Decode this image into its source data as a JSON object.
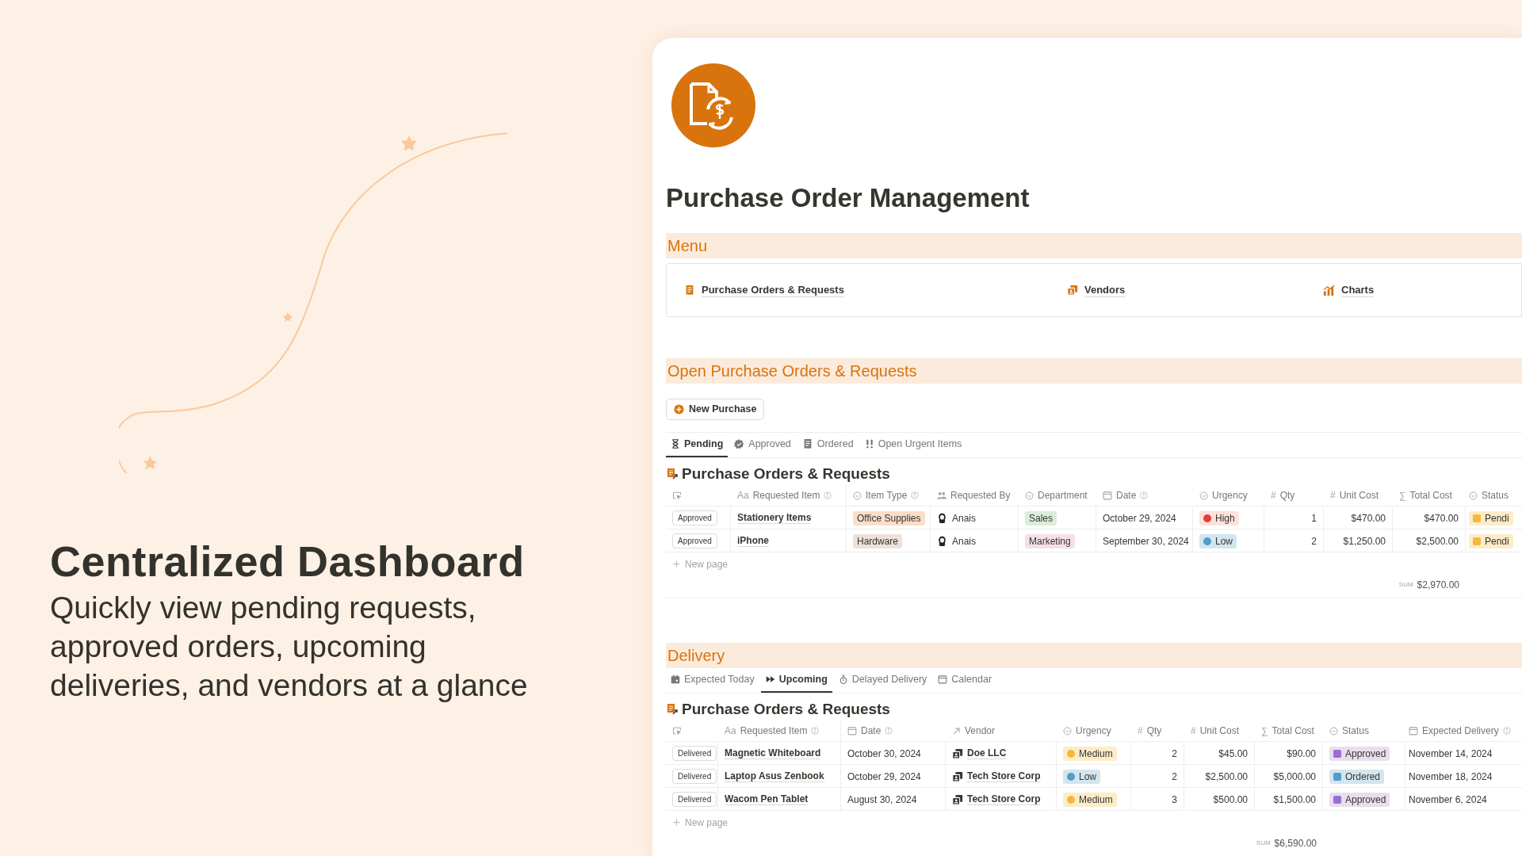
{
  "hero": {
    "heading": "Centralized Dashboard",
    "body": "Quickly view pending requests, approved orders, upcoming deliveries, and vendors at a glance"
  },
  "page": {
    "title": "Purchase Order Management"
  },
  "menu": {
    "heading": "Menu",
    "items": [
      {
        "label": "Purchase Orders & Requests"
      },
      {
        "label": "Vendors"
      },
      {
        "label": "Charts"
      }
    ]
  },
  "open_orders": {
    "heading": "Open Purchase Orders & Requests",
    "new_button": "New Purchase",
    "tabs": [
      {
        "label": "Pending",
        "selected": true
      },
      {
        "label": "Approved",
        "selected": false
      },
      {
        "label": "Ordered",
        "selected": false
      },
      {
        "label": "Open Urgent Items",
        "selected": false
      }
    ],
    "table": {
      "title": "Purchase Orders & Requests",
      "columns": [
        {
          "kind": "button"
        },
        {
          "kind": "title",
          "glyph": "Aa",
          "label": "Requested Item",
          "info": true
        },
        {
          "kind": "tag",
          "label": "Item Type",
          "info": true
        },
        {
          "kind": "person",
          "label": "Requested By",
          "info": false
        },
        {
          "kind": "tag",
          "label": "Department",
          "info": false
        },
        {
          "kind": "date",
          "label": "Date",
          "info": true
        },
        {
          "kind": "priority",
          "label": "Urgency",
          "info": false
        },
        {
          "kind": "number",
          "glyph": "#",
          "label": "Qty",
          "info": false
        },
        {
          "kind": "number",
          "glyph": "#",
          "label": "Unit Cost",
          "info": false
        },
        {
          "kind": "formula",
          "glyph": "∑",
          "label": "Total Cost",
          "info": false
        },
        {
          "kind": "status",
          "label": "Status",
          "info": false
        }
      ],
      "rows": [
        {
          "cells": [
            "Approved",
            "Stationery Items",
            {
              "text": "Office Supplies",
              "color": "#fadec9"
            },
            "Anais",
            {
              "text": "Sales",
              "color": "#dbeddb"
            },
            "October 29, 2024",
            {
              "text": "High",
              "color": "#e03e3e"
            },
            "1",
            "$470.00",
            "$470.00",
            {
              "text": "Pendi",
              "color": "#f5b83d"
            }
          ]
        },
        {
          "cells": [
            "Approved",
            "iPhone",
            {
              "text": "Hardware",
              "color": "#eee0da"
            },
            "Anais",
            {
              "text": "Marketing",
              "color": "#f5e0e9"
            },
            "September 30, 2024",
            {
              "text": "Low",
              "color": "#529cca"
            },
            "2",
            "$1,250.00",
            "$2,500.00",
            {
              "text": "Pendi",
              "color": "#f5b83d"
            }
          ]
        }
      ],
      "new_row": "New page",
      "sum_label": "SUM",
      "sum_value": "$2,970.00"
    }
  },
  "delivery": {
    "heading": "Delivery",
    "tabs": [
      {
        "label": "Expected Today",
        "selected": false
      },
      {
        "label": "Upcoming",
        "selected": true
      },
      {
        "label": "Delayed Delivery",
        "selected": false
      },
      {
        "label": "Calendar",
        "selected": false
      }
    ],
    "table": {
      "title": "Purchase Orders & Requests",
      "columns": [
        {
          "kind": "button"
        },
        {
          "kind": "title",
          "glyph": "Aa",
          "label": "Requested Item",
          "info": true
        },
        {
          "kind": "date",
          "label": "Date",
          "info": true
        },
        {
          "kind": "relation",
          "label": "Vendor",
          "info": false
        },
        {
          "kind": "priority",
          "label": "Urgency",
          "info": false
        },
        {
          "kind": "number",
          "glyph": "#",
          "label": "Qty",
          "info": false
        },
        {
          "kind": "number",
          "glyph": "#",
          "label": "Unit Cost",
          "info": false
        },
        {
          "kind": "formula",
          "glyph": "∑",
          "label": "Total Cost",
          "info": false
        },
        {
          "kind": "status",
          "label": "Status",
          "info": false
        },
        {
          "kind": "date",
          "label": "Expected Delivery",
          "info": true
        }
      ],
      "rows": [
        {
          "cells": [
            "Delivered",
            "Magnetic Whiteboard",
            "October 30, 2024",
            "Doe LLC",
            {
              "text": "Medium",
              "color": "#f5b83d"
            },
            "2",
            "$45.00",
            "$90.00",
            {
              "text": "Approved",
              "color": "#9a6dd7"
            },
            "November 14, 2024"
          ]
        },
        {
          "cells": [
            "Delivered",
            "Laptop Asus Zenbook",
            "October 29, 2024",
            "Tech Store Corp",
            {
              "text": "Low",
              "color": "#529cca"
            },
            "2",
            "$2,500.00",
            "$5,000.00",
            {
              "text": "Ordered",
              "color": "#529cca"
            },
            "November 18, 2024"
          ]
        },
        {
          "cells": [
            "Delivered",
            "Wacom Pen Tablet",
            "August 30, 2024",
            "Tech Store Corp",
            {
              "text": "Medium",
              "color": "#f5b83d"
            },
            "3",
            "$500.00",
            "$1,500.00",
            {
              "text": "Approved",
              "color": "#9a6dd7"
            },
            "November 6, 2024"
          ]
        }
      ],
      "new_row": "New page",
      "sum_label": "SUM",
      "sum_value": "$6,590.00"
    }
  }
}
